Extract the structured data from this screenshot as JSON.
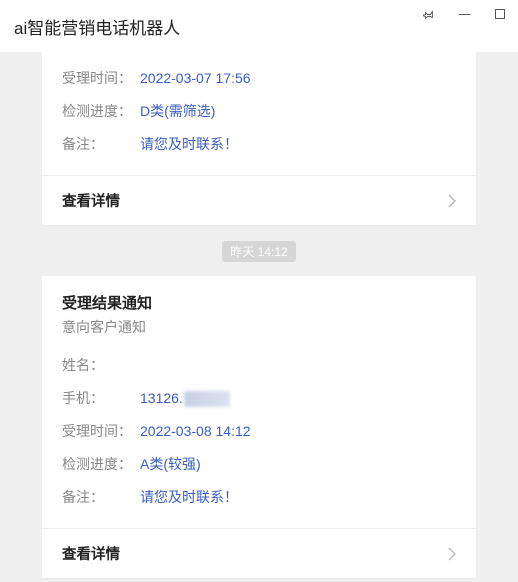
{
  "window": {
    "title": "ai智能营销电话机器人"
  },
  "cards": [
    {
      "rows": [
        {
          "label": "受理时间：",
          "value": "2022-03-07 17:56"
        },
        {
          "label": "检测进度：",
          "value": "D类(需筛选)"
        },
        {
          "label": "备注：",
          "value": "请您及时联系！"
        }
      ],
      "footer_label": "查看详情"
    },
    {
      "title": "受理结果通知",
      "subtitle": "意向客户通知",
      "rows": [
        {
          "label": "姓名：",
          "value": ""
        },
        {
          "label": "手机：",
          "value": "13126.",
          "phone_partial": true
        },
        {
          "label": "受理时间：",
          "value": "2022-03-08 14:12"
        },
        {
          "label": "检测进度：",
          "value": "A类(较强)"
        },
        {
          "label": "备注：",
          "value": "请您及时联系！"
        }
      ],
      "footer_label": "查看详情"
    }
  ],
  "timestamp_separator": "昨天  14:12"
}
